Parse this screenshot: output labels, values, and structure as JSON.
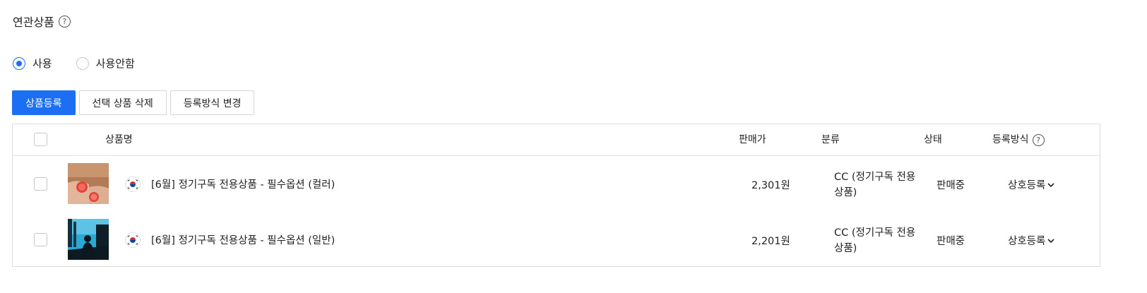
{
  "section": {
    "title": "연관상품",
    "help_glyph": "?"
  },
  "usage": {
    "options": [
      {
        "label": "사용",
        "checked": true
      },
      {
        "label": "사용안함",
        "checked": false
      }
    ]
  },
  "toolbar": {
    "register_label": "상품등록",
    "delete_label": "선택 상품 삭제",
    "change_method_label": "등록방식 변경"
  },
  "table": {
    "headers": {
      "name": "상품명",
      "price": "판매가",
      "category": "분류",
      "status": "상태",
      "method": "등록방식"
    },
    "rows": [
      {
        "image": "grapefruit-hands-photo",
        "flag": "korea-flag-icon",
        "name": "[6월] 정기구독 전용상품 - 필수옵션 (컬러)",
        "price": "2,301원",
        "category_line1": "CC (정기구독 전용",
        "category_line2": "상품)",
        "status": "판매중",
        "method": "상호등록"
      },
      {
        "image": "city-silhouette-photo",
        "flag": "korea-flag-icon",
        "name": "[6월] 정기구독 전용상품 - 필수옵션 (일반)",
        "price": "2,201원",
        "category_line1": "CC (정기구독 전용",
        "category_line2": "상품)",
        "status": "판매중",
        "method": "상호등록"
      }
    ]
  },
  "colors": {
    "accent": "#1c6ef2",
    "border": "#dcdcdc"
  }
}
